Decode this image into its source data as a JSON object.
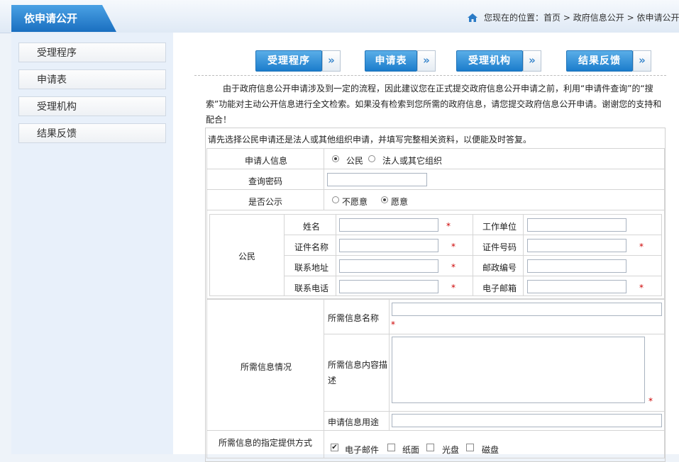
{
  "header": {
    "title": "依申请公开",
    "breadcrumb_label": "您现在的位置：",
    "breadcrumb_home": "首页",
    "breadcrumb_sep": ">",
    "breadcrumb_section": "政府信息公开",
    "breadcrumb_current": "依申请公开"
  },
  "sidebar": {
    "items": [
      {
        "label": "受理程序"
      },
      {
        "label": "申请表"
      },
      {
        "label": "受理机构"
      },
      {
        "label": "结果反馈"
      }
    ]
  },
  "buttons": [
    {
      "label": "受理程序",
      "arrow": "»"
    },
    {
      "label": "申请表",
      "arrow": "»"
    },
    {
      "label": "受理机构",
      "arrow": "»"
    },
    {
      "label": "结果反馈",
      "arrow": "»"
    }
  ],
  "intro": "由于政府信息公开申请涉及到一定的流程，因此建议您在正式提交政府信息公开申请之前，利用“申请件查询”的“搜索”功能对主动公开信息进行全文检索。如果没有检索到您所需的政府信息，请您提交政府信息公开申请。谢谢您的支持和配合！",
  "form": {
    "notice": "请先选择公民申请还是法人或其他组织申请，并填写完整相关资料，以便能及时答复。",
    "applicant_label": "申请人信息",
    "applicant_options": [
      "公民",
      "法人或其它组织"
    ],
    "password_label": "查询密码",
    "public_label": "是否公示",
    "public_options": [
      "不愿意",
      "愿意"
    ],
    "citizen_label": "公民",
    "citizen_fields": {
      "name": "姓名",
      "work": "工作单位",
      "id_name": "证件名称",
      "id_no": "证件号码",
      "address": "联系地址",
      "postcode": "邮政编号",
      "phone": "联系电话",
      "email": "电子邮箱"
    },
    "required_mark": "*",
    "info_section_label": "所需信息情况",
    "info_name_label": "所需信息名称",
    "info_desc_label": "所需信息内容描述",
    "info_use_label": "申请信息用途",
    "method_label": "所需信息的指定提供方式",
    "method_options": [
      "电子邮件",
      "纸面",
      "光盘",
      "磁盘"
    ]
  },
  "colors": {
    "accent": "#1b7ccc",
    "required": "#cc0000"
  }
}
